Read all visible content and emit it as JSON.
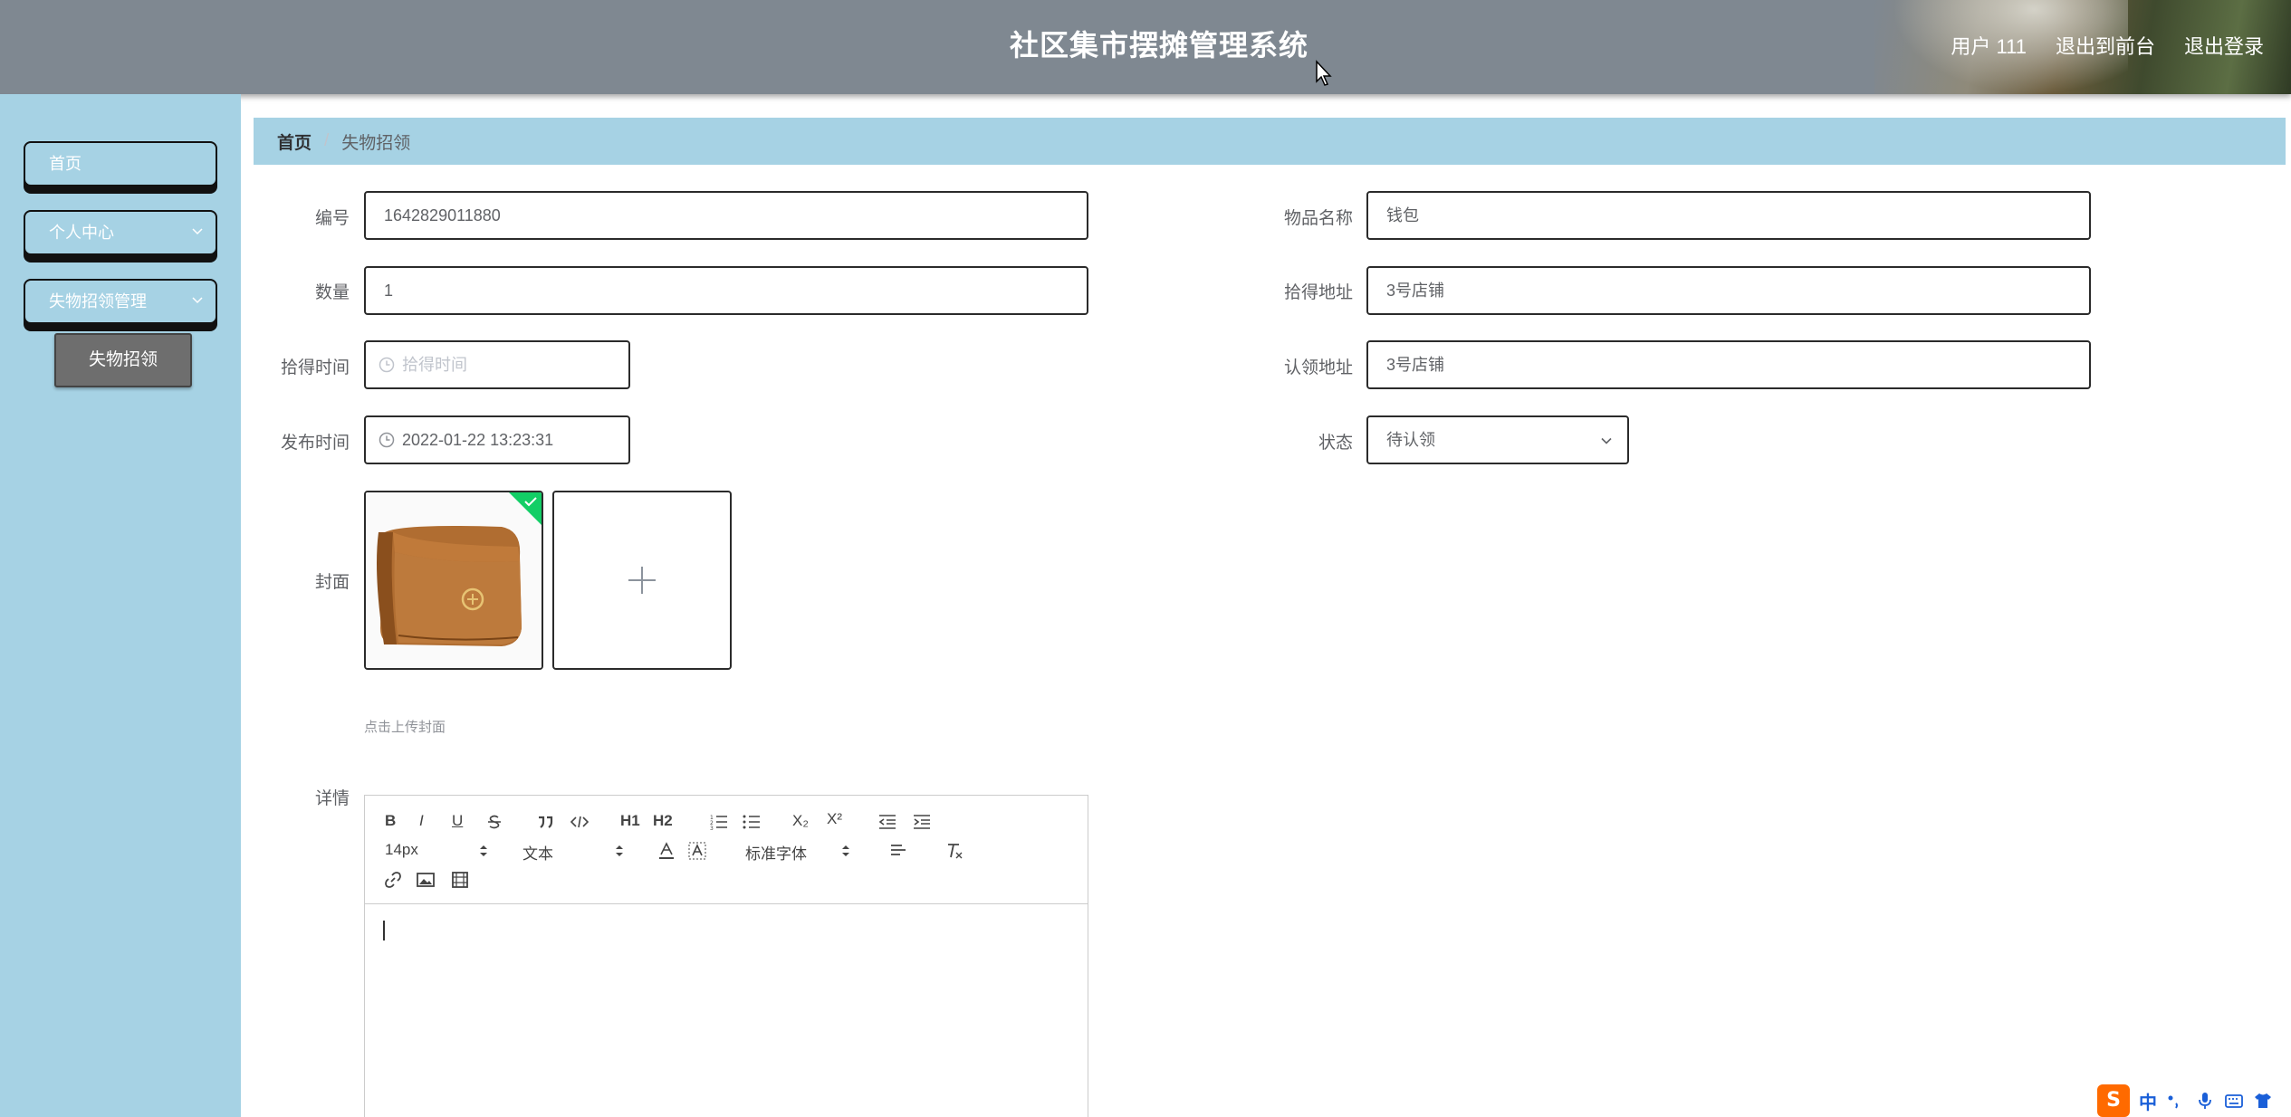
{
  "header": {
    "title": "社区集市摆摊管理系统",
    "user": "用户 111",
    "to_frontend": "退出到前台",
    "logout": "退出登录"
  },
  "sidebar": {
    "items": [
      {
        "label": "首页"
      },
      {
        "label": "个人中心"
      },
      {
        "label": "失物招领管理"
      }
    ],
    "submenu": {
      "label": "失物招领"
    }
  },
  "breadcrumb": {
    "home": "首页",
    "separator": "/",
    "current": "失物招领"
  },
  "form": {
    "number": {
      "label": "编号",
      "value": "1642829011880"
    },
    "item_name": {
      "label": "物品名称",
      "value": "钱包"
    },
    "quantity": {
      "label": "数量",
      "value": "1"
    },
    "found_address": {
      "label": "拾得地址",
      "value": "3号店铺"
    },
    "found_time": {
      "label": "拾得时间",
      "placeholder": "拾得时间"
    },
    "claim_address": {
      "label": "认领地址",
      "value": "3号店铺"
    },
    "publish_time": {
      "label": "发布时间",
      "value": "2022-01-22 13:23:31"
    },
    "status": {
      "label": "状态",
      "value": "待认领"
    },
    "cover": {
      "label": "封面",
      "tip": "点击上传封面"
    },
    "detail": {
      "label": "详情"
    }
  },
  "editor": {
    "toolbar": {
      "bold": "B",
      "italic": "I",
      "underline": "U",
      "h1": "H1",
      "h2": "H2",
      "subscript": "X₂",
      "superscript": "X²",
      "font_size": "14px",
      "text_type": "文本",
      "font_family": "标准字体"
    }
  },
  "ime": {
    "lang": "中"
  },
  "colors": {
    "header_bg": "#7f8891",
    "sidebar_bg": "#a6d2e4",
    "success": "#13ce66"
  }
}
